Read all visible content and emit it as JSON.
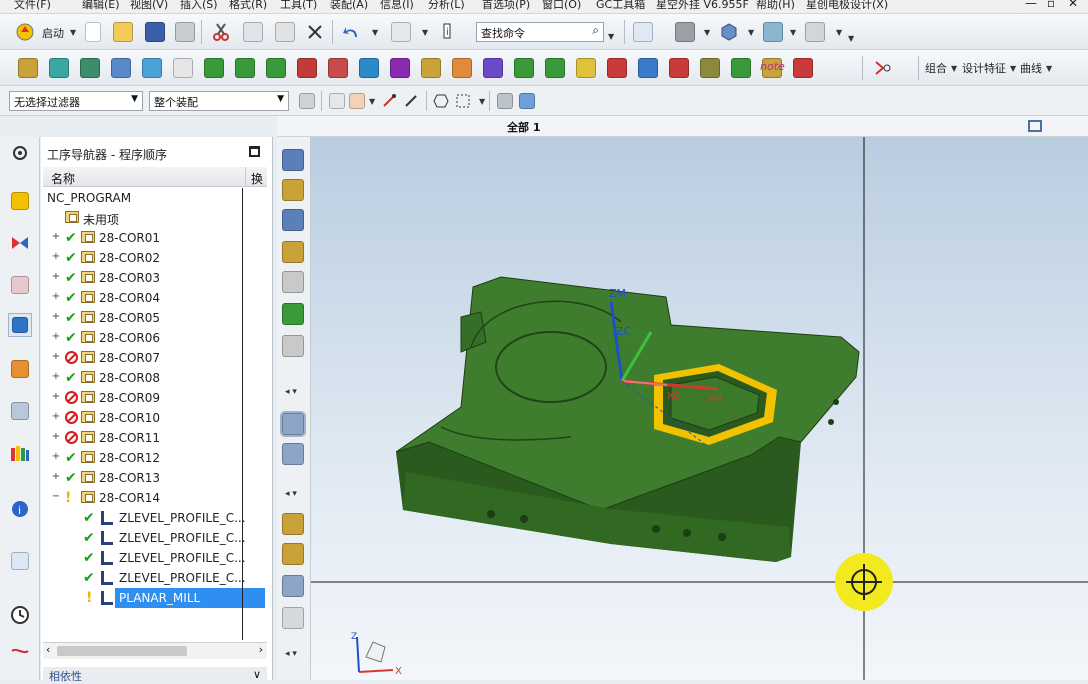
{
  "menu": [
    "文件(F)",
    "编辑(E)",
    "视图(V)",
    "插入(S)",
    "格式(R)",
    "工具(T)",
    "装配(A)",
    "信息(I)",
    "分析(L)",
    "首选项(P)",
    "窗口(O)",
    "GC工具箱",
    "星空外挂 V6.955F",
    "帮助(H)",
    "星创电极设计(X)"
  ],
  "toolbar1": {
    "start_label": "启动",
    "search_placeholder": "查找命令"
  },
  "toolbar2": {
    "combine_label": "组合",
    "design_feature_label": "设计特征",
    "curve_label": "曲线",
    "note_label": "note"
  },
  "selection": {
    "filter_value": "无选择过滤器",
    "scope_value": "整个装配"
  },
  "viewport": {
    "tab_label": "全部 1"
  },
  "navigator": {
    "title": "工序导航器 - 程序顺序",
    "col_name": "名称",
    "col_switch": "换",
    "root": "NC_PROGRAM",
    "unused": "未用项",
    "programs": [
      {
        "name": "28-COR01",
        "status": "ok"
      },
      {
        "name": "28-COR02",
        "status": "ok"
      },
      {
        "name": "28-COR03",
        "status": "ok"
      },
      {
        "name": "28-COR04",
        "status": "ok"
      },
      {
        "name": "28-COR05",
        "status": "ok"
      },
      {
        "name": "28-COR06",
        "status": "ok"
      },
      {
        "name": "28-COR07",
        "status": "stop"
      },
      {
        "name": "28-COR08",
        "status": "ok"
      },
      {
        "name": "28-COR09",
        "status": "stop"
      },
      {
        "name": "28-COR10",
        "status": "stop"
      },
      {
        "name": "28-COR11",
        "status": "stop"
      },
      {
        "name": "28-COR12",
        "status": "ok"
      },
      {
        "name": "28-COR13",
        "status": "ok"
      },
      {
        "name": "28-COR14",
        "status": "warn"
      }
    ],
    "operations": [
      {
        "name": "ZLEVEL_PROFILE_C...",
        "status": "ok"
      },
      {
        "name": "ZLEVEL_PROFILE_C...",
        "status": "ok"
      },
      {
        "name": "ZLEVEL_PROFILE_C...",
        "status": "ok"
      },
      {
        "name": "ZLEVEL_PROFILE_C...",
        "status": "ok"
      },
      {
        "name": "PLANAR_MILL",
        "status": "warn"
      }
    ],
    "bottom_label": "相依性"
  },
  "axes": {
    "zm": "ZM",
    "zc": "ZC",
    "yc": "YC",
    "xc": "XC",
    "xm": "XM",
    "x": "X",
    "z": "Z"
  },
  "colors": {
    "part_green": "#3d7a2e",
    "highlight_yellow": "#f2c200",
    "selection_blue": "#2f8ff0"
  }
}
